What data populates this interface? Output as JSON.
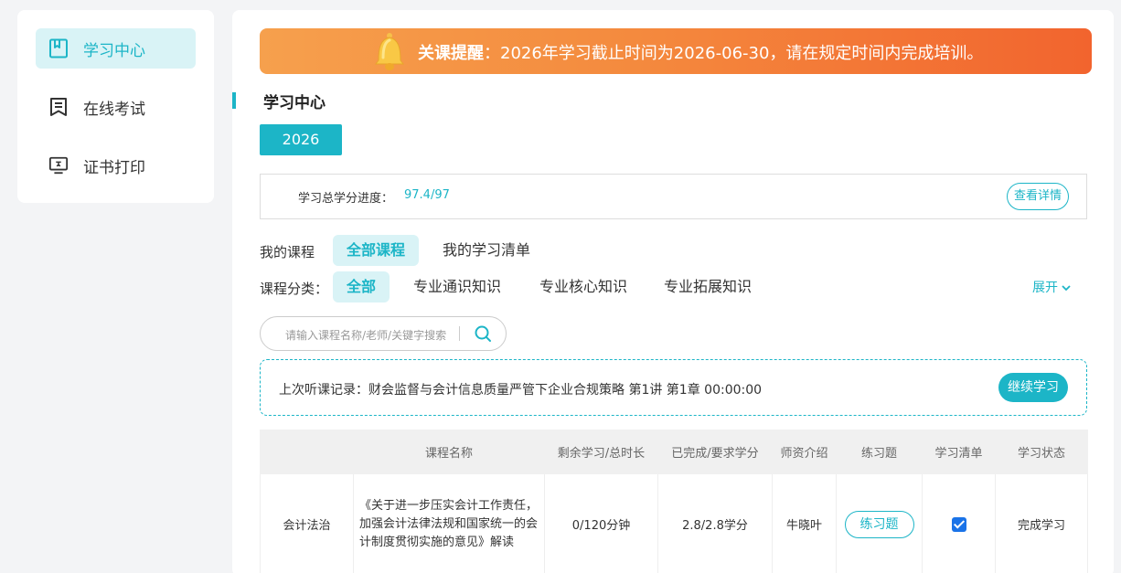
{
  "sidebar": {
    "items": [
      {
        "label": "学习中心",
        "icon": "book-icon",
        "active": true
      },
      {
        "label": "在线考试",
        "icon": "exam-icon",
        "active": false
      },
      {
        "label": "证书打印",
        "icon": "certificate-icon",
        "active": false
      }
    ]
  },
  "banner": {
    "bold": "关课提醒",
    "text": "：2026年学习截止时间为2026-06-30，请在规定时间内完成培训。",
    "icon": "bell-icon"
  },
  "section_title": "学习中心",
  "year_button": "2026",
  "progress": {
    "label": "学习总学分进度：",
    "value": "97.4/97",
    "detail_button": "查看详情"
  },
  "my_courses": {
    "label": "我的课程",
    "tabs": [
      "全部课程",
      "我的学习清单"
    ]
  },
  "category": {
    "label": "课程分类：",
    "options": [
      "全部",
      "专业通识知识",
      "专业核心知识",
      "专业拓展知识"
    ],
    "expand": "展开"
  },
  "search": {
    "placeholder": "请输入课程名称/老师/关键字搜索",
    "icon": "search-icon"
  },
  "last_record": {
    "text": "上次听课记录：财会监督与会计信息质量严管下企业合规策略 第1讲 第1章 00:00:00",
    "button": "继续学习"
  },
  "table": {
    "headers": [
      "",
      "课程名称",
      "剩余学习/总时长",
      "已完成/要求学分",
      "师资介绍",
      "练习题",
      "学习清单",
      "学习状态"
    ],
    "rows": [
      {
        "category": "会计法治",
        "name": "《关于进一步压实会计工作责任，加强会计法律法规和国家统一的会计制度贯彻实施的意见》解读",
        "time": "0/120分钟",
        "credits": "2.8/2.8学分",
        "teacher": "牛晓叶",
        "exercise": "练习题",
        "in_list": true,
        "status": "完成学习"
      }
    ]
  },
  "colors": {
    "accent": "#1cb5c7",
    "banner_start": "#f6a04d",
    "banner_end": "#f2642e",
    "checkbox": "#1a73e8"
  }
}
